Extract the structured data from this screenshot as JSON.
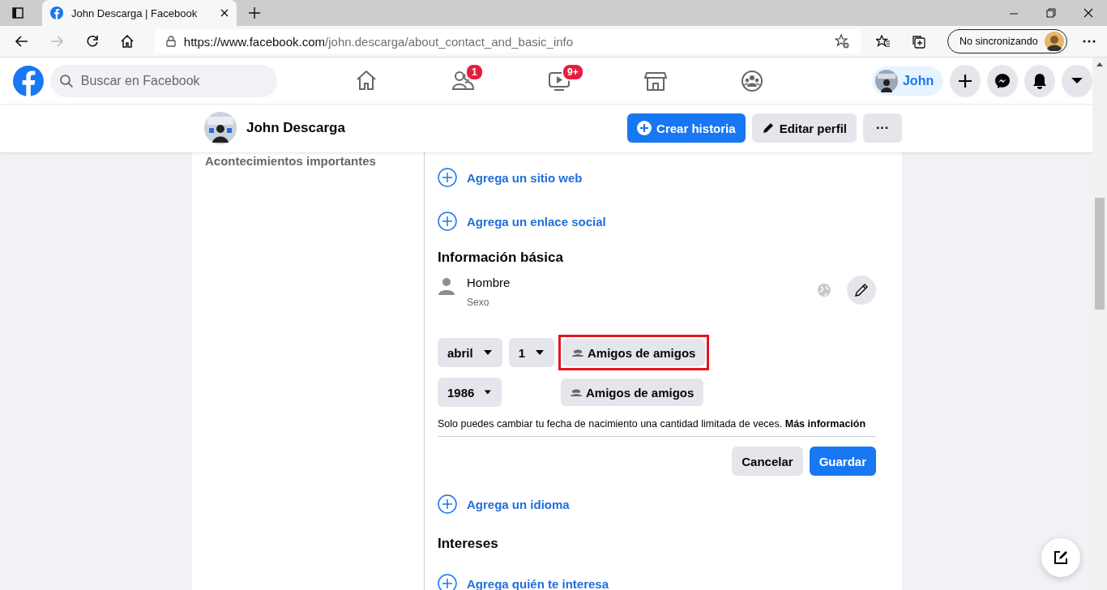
{
  "browser": {
    "tab_title": "John Descarga | Facebook",
    "url_host": "https://www.facebook.com",
    "url_path": "/john.descarga/about_contact_and_basic_info",
    "sync_label": "No sincronizando"
  },
  "nav": {
    "search_placeholder": "Buscar en Facebook",
    "tabs": [
      {
        "kind": "home",
        "selected": false
      },
      {
        "kind": "friends",
        "selected": false,
        "badge": "1"
      },
      {
        "kind": "watch",
        "selected": false,
        "badge": "9+"
      },
      {
        "kind": "marketplace",
        "selected": false
      },
      {
        "kind": "groups",
        "selected": false
      }
    ],
    "profile_chip": "John"
  },
  "profile_bar": {
    "name": "John Descarga",
    "buttons": [
      {
        "kind": "primary",
        "label": "Crear historia"
      },
      {
        "kind": "edit",
        "label": "Editar perfil"
      },
      {
        "kind": "more",
        "label": "···"
      }
    ]
  },
  "sidebar": {
    "items": [
      "Acontecimientos importantes"
    ]
  },
  "about": {
    "add_links": [
      "Agrega un sitio web",
      "Agrega un enlace social"
    ],
    "basic_info": {
      "heading": "Información básica",
      "gender": {
        "value": "Hombre",
        "label": "Sexo"
      },
      "birthday": {
        "month": "abril",
        "day": "1",
        "year": "1986",
        "date_privacy": {
          "label": "Amigos de amigos",
          "highlighted": true
        },
        "year_privacy": {
          "label": "Amigos de amigos",
          "highlighted": false
        },
        "note": "Solo puedes cambiar tu fecha de nacimiento una cantidad limitada de veces.",
        "note_link": "Más información",
        "buttons": [
          {
            "kind": "cancel",
            "label": "Cancelar"
          },
          {
            "kind": "save",
            "label": "Guardar"
          }
        ]
      }
    },
    "add_language": "Agrega un idioma",
    "interests": {
      "heading": "Intereses",
      "add": "Agrega quién te interesa"
    }
  }
}
